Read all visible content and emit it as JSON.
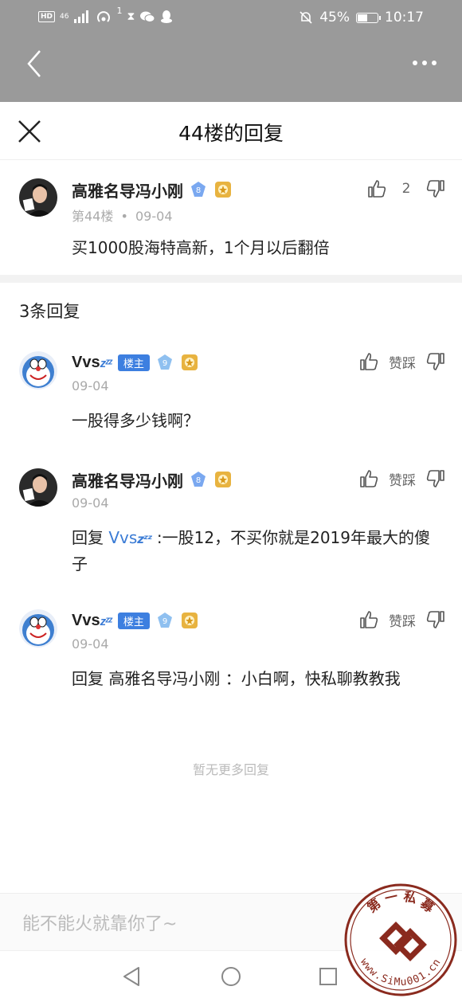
{
  "statusbar": {
    "signal_label": "46",
    "sim_badge": "HD",
    "hotspot_count": "1",
    "battery_percent": "45%",
    "battery_level": 0.45,
    "time": "10:17"
  },
  "sheet": {
    "title": "44楼的回复"
  },
  "main_comment": {
    "username": "高雅名导冯小刚",
    "level": "8",
    "likes": "2",
    "floor": "第44楼",
    "dot": "•",
    "date": "09-04",
    "text": "买1000股海特高新，1个月以后翻倍"
  },
  "replies_header": "3条回复",
  "replies": [
    {
      "username": "Vvs",
      "zzz": "zᶻᶻ",
      "badge": "楼主",
      "level": "9",
      "date": "09-04",
      "action_label": "赞踩",
      "text": "一股得多少钱啊？"
    },
    {
      "username": "高雅名导冯小刚",
      "level": "8",
      "date": "09-04",
      "action_label": "赞踩",
      "reply_prefix": "回复 ",
      "reply_to": "Vvs",
      "reply_zzz": "zᶻᶻ",
      "text": " :一股12，不买你就是2019年最大的傻子"
    },
    {
      "username": "Vvs",
      "zzz": "zᶻᶻ",
      "badge": "楼主",
      "level": "9",
      "date": "09-04",
      "action_label": "赞踩",
      "text": "回复 高雅名导冯小刚 ：小白啊，快私聊教教我"
    }
  ],
  "no_more": "暂无更多回复",
  "input": {
    "placeholder": "能不能火就靠你了~"
  },
  "watermark": {
    "text_top": "第 一 私 募",
    "text_bottom": "www.SiMu001.cn"
  },
  "colors": {
    "accent": "#3a7bd5",
    "badge": "#3d7fe0",
    "overlay": "#9a9a9a"
  }
}
